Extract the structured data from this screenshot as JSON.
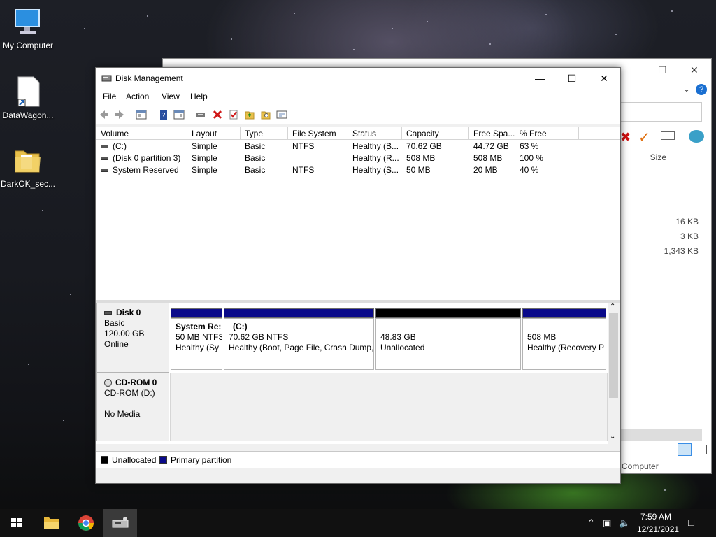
{
  "desktop": {
    "icons": [
      {
        "label": "My Computer"
      },
      {
        "label": "DataWagon..."
      },
      {
        "label": "DarkOK_sec..."
      }
    ]
  },
  "background_window": {
    "size_header": "Size",
    "size_values": [
      "16 KB",
      "3 KB",
      "1,343 KB"
    ],
    "status_text": "Computer"
  },
  "window": {
    "title": "Disk Management",
    "menu": [
      "File",
      "Action",
      "View",
      "Help"
    ]
  },
  "volume_list": {
    "columns": [
      "Volume",
      "Layout",
      "Type",
      "File System",
      "Status",
      "Capacity",
      "Free Spa...",
      "% Free"
    ],
    "rows": [
      [
        "(C:)",
        "Simple",
        "Basic",
        "NTFS",
        "Healthy (B...",
        "70.62 GB",
        "44.72 GB",
        "63 %"
      ],
      [
        "(Disk 0 partition 3)",
        "Simple",
        "Basic",
        "",
        "Healthy (R...",
        "508 MB",
        "508 MB",
        "100 %"
      ],
      [
        "System Reserved",
        "Simple",
        "Basic",
        "NTFS",
        "Healthy (S...",
        "50 MB",
        "20 MB",
        "40 %"
      ]
    ]
  },
  "disks": {
    "disk0": {
      "name": "Disk 0",
      "type": "Basic",
      "size": "120.00 GB",
      "state": "Online",
      "partitions": [
        {
          "name": "System Re:",
          "size": "50 MB NTFS",
          "status": "Healthy (Sy",
          "kind": "primary"
        },
        {
          "name": "(C:)",
          "size": "70.62 GB NTFS",
          "status": "Healthy (Boot, Page File, Crash Dump,",
          "kind": "primary"
        },
        {
          "name": "",
          "size": "48.83 GB",
          "status": "Unallocated",
          "kind": "unallocated"
        },
        {
          "name": "",
          "size": "508 MB",
          "status": "Healthy (Recovery P",
          "kind": "primary"
        }
      ]
    },
    "cdrom0": {
      "name": "CD-ROM 0",
      "drive": "CD-ROM (D:)",
      "media": "No Media"
    }
  },
  "legend": {
    "unallocated": "Unallocated",
    "primary": "Primary partition",
    "unallocated_color": "#000000",
    "primary_color": "#0a0a8a"
  },
  "taskbar": {
    "time": "7:59 AM",
    "date": "12/21/2021"
  }
}
